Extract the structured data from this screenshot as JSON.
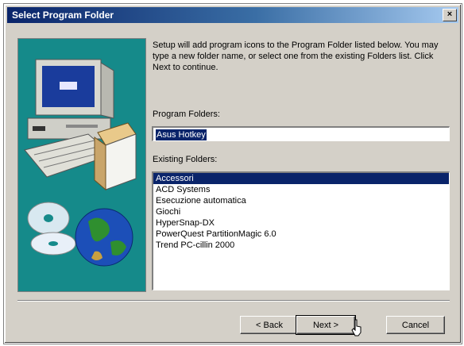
{
  "window": {
    "title": "Select Program Folder",
    "close_label": "×"
  },
  "description": "Setup will add program icons to the Program Folder listed below. You may type a new folder name, or select one from the existing Folders list. Click Next to continue.",
  "program_folders": {
    "label": "Program Folders:",
    "value": "Asus Hotkey"
  },
  "existing_folders": {
    "label": "Existing Folders:",
    "items": [
      {
        "label": "Accessori",
        "selected": true
      },
      {
        "label": "ACD Systems",
        "selected": false
      },
      {
        "label": "Esecuzione automatica",
        "selected": false
      },
      {
        "label": "Giochi",
        "selected": false
      },
      {
        "label": "HyperSnap-DX",
        "selected": false
      },
      {
        "label": "PowerQuest PartitionMagic 6.0",
        "selected": false
      },
      {
        "label": "Trend PC-cillin 2000",
        "selected": false
      }
    ]
  },
  "buttons": {
    "back": "< Back",
    "next": "Next >",
    "cancel": "Cancel"
  },
  "colors": {
    "title_bar": "#0a246a",
    "selection": "#0a246a",
    "art_background": "#158a8a",
    "dialog_face": "#d4d0c8"
  }
}
